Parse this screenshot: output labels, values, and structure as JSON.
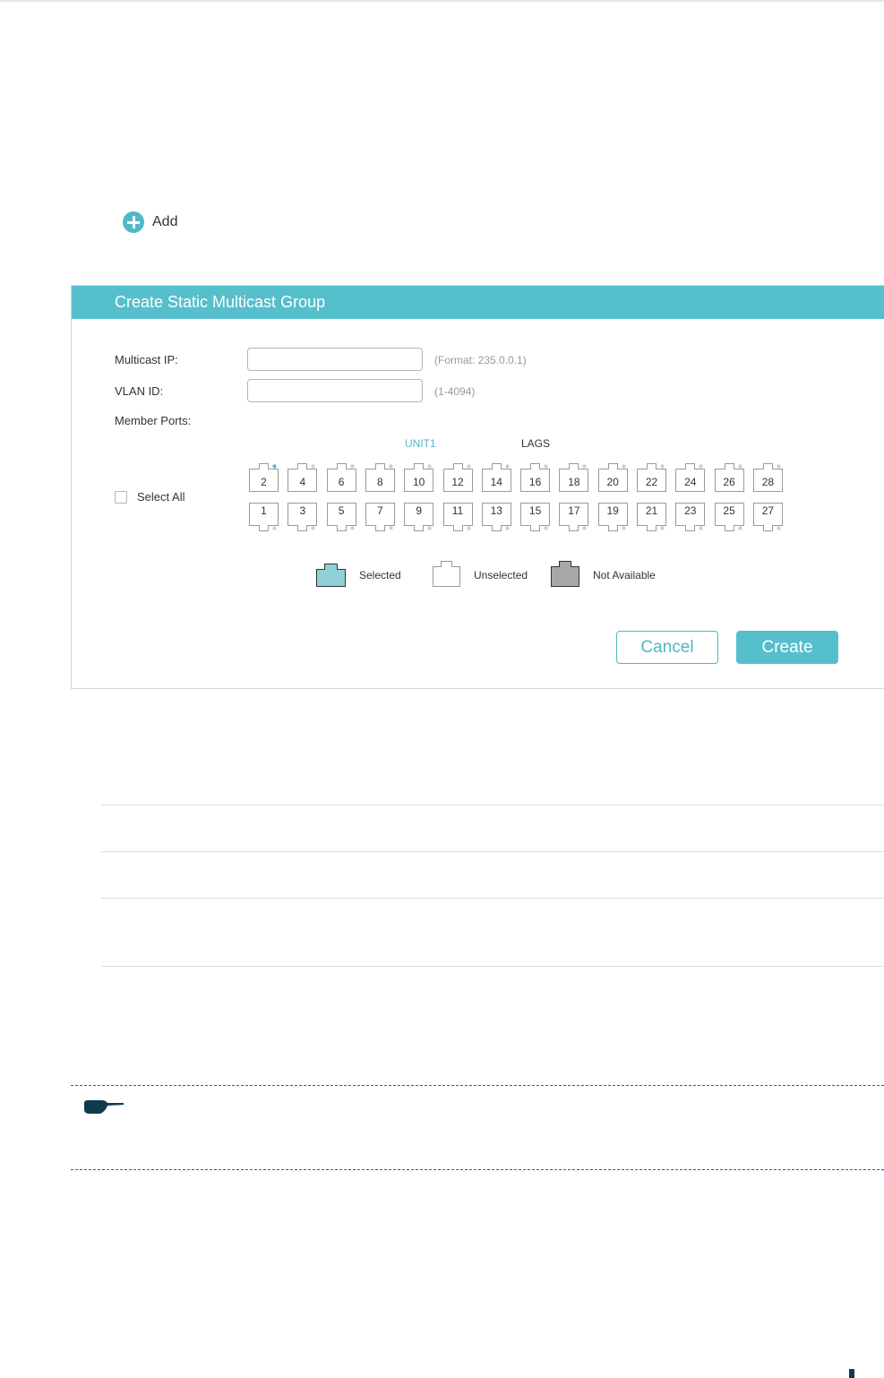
{
  "toolbar": {
    "add_label": "Add"
  },
  "dialog": {
    "title": "Create Static Multicast Group",
    "multicast_ip": {
      "label": "Multicast IP:",
      "value": "",
      "hint": "(Format: 235.0.0.1)"
    },
    "vlan_id": {
      "label": "VLAN ID:",
      "value": "",
      "hint": "(1-4094)"
    },
    "member_ports": {
      "label": "Member Ports:",
      "tabs": [
        {
          "label": "UNIT1",
          "active": true
        },
        {
          "label": "LAGS",
          "active": false
        }
      ],
      "select_all_label": "Select All",
      "top_row": [
        "2",
        "4",
        "6",
        "8",
        "10",
        "12",
        "14",
        "16",
        "18",
        "20",
        "22",
        "24",
        "26",
        "28"
      ],
      "bottom_row": [
        "1",
        "3",
        "5",
        "7",
        "9",
        "11",
        "13",
        "15",
        "17",
        "19",
        "21",
        "23",
        "25",
        "27"
      ],
      "link_up_port": "2"
    },
    "legend": [
      {
        "label": "Selected",
        "state": "selected"
      },
      {
        "label": "Unselected",
        "state": "unselected"
      },
      {
        "label": "Not Available",
        "state": "not-available"
      }
    ],
    "cancel_label": "Cancel",
    "create_label": "Create"
  },
  "colors": {
    "accent": "#55bfcc",
    "selected_fill": "#8fd0d9",
    "unavailable_fill": "#a8a8a8",
    "note_icon": "#0f3b4c"
  },
  "icons": {
    "add": "plus-circle-icon",
    "note": "pointing-hand-icon"
  }
}
